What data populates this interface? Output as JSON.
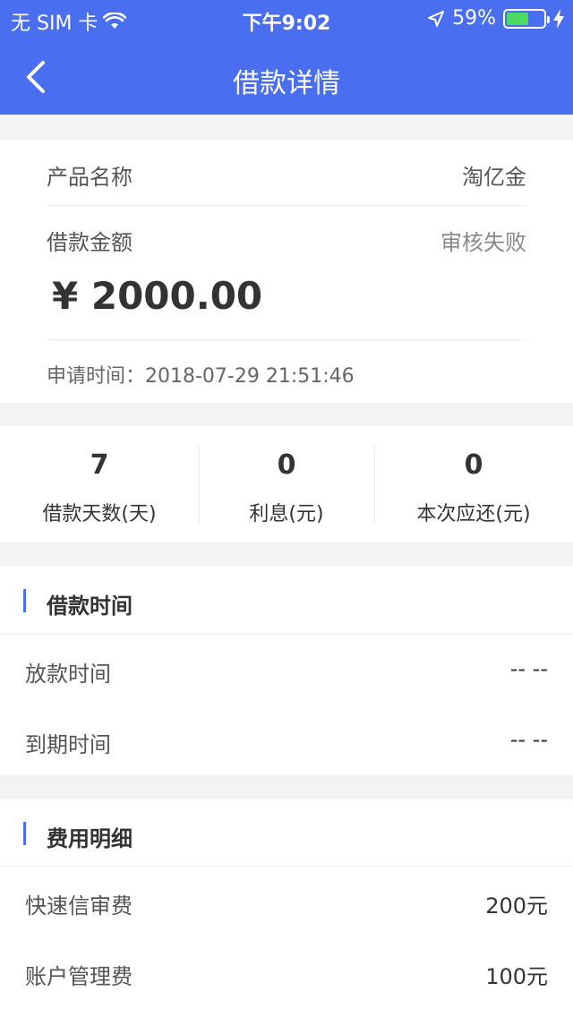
{
  "status_bar": {
    "carrier": "无 SIM 卡",
    "time": "下午9:02",
    "battery": "59%",
    "battery_level": 0.59
  },
  "nav": {
    "title": "借款详情"
  },
  "loan": {
    "product_label": "产品名称",
    "product_value": "淘亿金",
    "amount_label": "借款金额",
    "status": "审核失败",
    "amount": "¥ 2000.00",
    "apply_time": "申请时间：2018-07-29 21:51:46"
  },
  "stats": [
    {
      "value": "7",
      "label": "借款天数(天)"
    },
    {
      "value": "0",
      "label": "利息(元)"
    },
    {
      "value": "0",
      "label": "本次应还(元)"
    }
  ],
  "loan_time": {
    "title": "借款时间",
    "rows": [
      {
        "label": "放款时间",
        "value": "--  --"
      },
      {
        "label": "到期时间",
        "value": "--  --"
      }
    ]
  },
  "fees": {
    "title": "费用明细",
    "rows": [
      {
        "label": "快速信审费",
        "value": "200元"
      },
      {
        "label": "账户管理费",
        "value": "100元"
      }
    ]
  },
  "colors": {
    "accent": "#4a6ef0",
    "battery": "#4cd964"
  }
}
